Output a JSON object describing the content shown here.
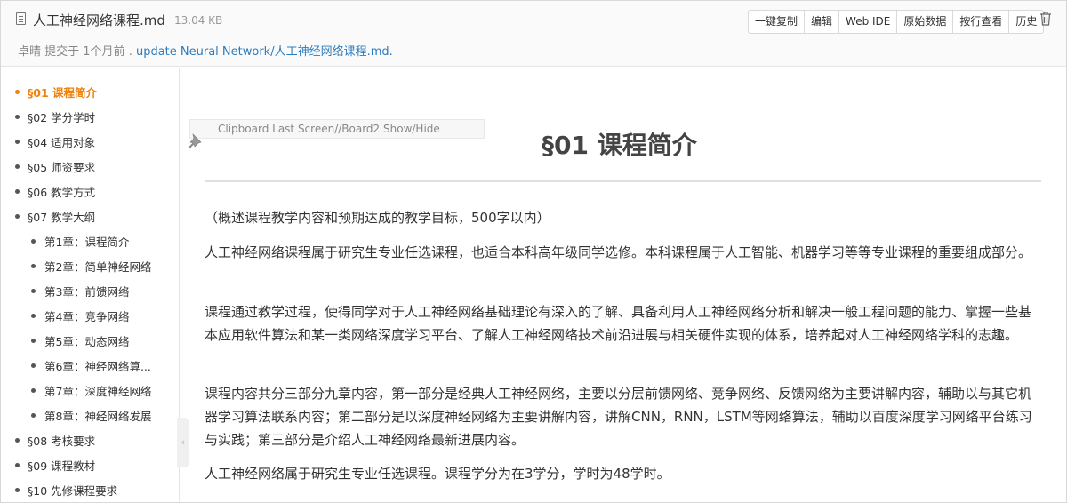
{
  "file": {
    "name": "人工神经网络课程.md",
    "size": "13.04 KB",
    "icon": "file-icon"
  },
  "commit": {
    "author": "卓晴",
    "action": "提交于 1个月前 .",
    "message": "update Neural Network/人工神经网络课程.md."
  },
  "toolbar": {
    "buttons": [
      "一键复制",
      "编辑",
      "Web IDE",
      "原始数据",
      "按行查看",
      "历史"
    ],
    "delete_icon": "trash-icon"
  },
  "toc": {
    "active_color": "#f0810f",
    "items": [
      {
        "label": "§01 课程简介",
        "level": 1,
        "active": true
      },
      {
        "label": "§02 学分学时",
        "level": 1,
        "active": false
      },
      {
        "label": "§04 适用对象",
        "level": 1,
        "active": false
      },
      {
        "label": "§05 师资要求",
        "level": 1,
        "active": false
      },
      {
        "label": "§06 教学方式",
        "level": 1,
        "active": false
      },
      {
        "label": "§07 教学大纲",
        "level": 1,
        "active": false
      },
      {
        "label": "第1章：课程简介",
        "level": 2,
        "active": false
      },
      {
        "label": "第2章：简单神经网络",
        "level": 2,
        "active": false
      },
      {
        "label": "第3章：前馈网络",
        "level": 2,
        "active": false
      },
      {
        "label": "第4章：竞争网络",
        "level": 2,
        "active": false
      },
      {
        "label": "第5章：动态网络",
        "level": 2,
        "active": false
      },
      {
        "label": "第6章：神经网络算...",
        "level": 2,
        "active": false
      },
      {
        "label": "第7章：深度神经网络",
        "level": 2,
        "active": false
      },
      {
        "label": "第8章：神经网络发展",
        "level": 2,
        "active": false
      },
      {
        "label": "§08 考核要求",
        "level": 1,
        "active": false
      },
      {
        "label": "§09 课程教材",
        "level": 1,
        "active": false
      },
      {
        "label": "§10 先修课程要求",
        "level": 1,
        "active": false
      }
    ]
  },
  "overlay": {
    "clipboard_label": "Clipboard Last Screen//Board2 Show/Hide"
  },
  "document": {
    "title": "§01 课程简介",
    "paragraphs": [
      "（概述课程教学内容和预期达成的教学目标，500字以内）",
      "人工神经网络课程属于研究生专业任选课程，也适合本科高年级同学选修。本科课程属于人工智能、机器学习等等专业课程的重要组成部分。",
      "课程通过教学过程，使得同学对于人工神经网络基础理论有深入的了解、具备利用人工神经网络分析和解决一般工程问题的能力、掌握一些基本应用软件算法和某一类网络深度学习平台、了解人工神经网络技术前沿进展与相关硬件实现的体系，培养起对人工神经网络学科的志趣。",
      "课程内容共分三部分九章内容，第一部分是经典人工神经网络，主要以分层前馈网络、竞争网络、反馈网络为主要讲解内容，辅助以与其它机器学习算法联系内容；第二部分是以深度神经网络为主要讲解内容，讲解CNN，RNN，LSTM等网络算法，辅助以百度深度学习网络平台练习与实践；第三部分是介绍人工神经网络最新进展内容。",
      "人工神经网络属于研究生专业任选课程。课程学分为在3学分，学时为48学时。"
    ]
  }
}
